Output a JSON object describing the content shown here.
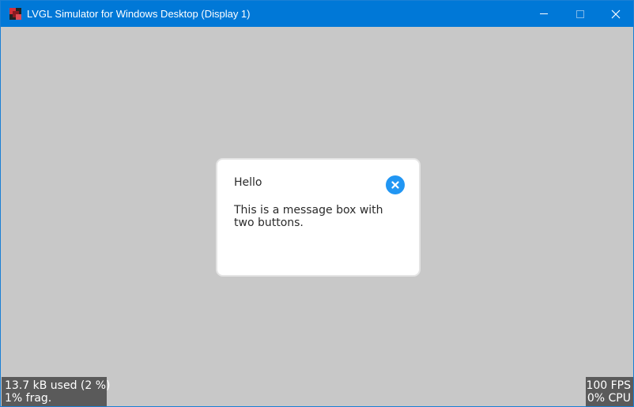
{
  "window": {
    "title": "LVGL Simulator for Windows Desktop (Display 1)"
  },
  "icons": {
    "app": "lvgl-app-icon",
    "minimize": "minimize-icon",
    "maximize": "maximize-icon",
    "close": "close-icon",
    "msgbox_close": "close-circle-icon"
  },
  "colors": {
    "titlebar": "#0078d7",
    "screen_bg": "#c8c8c8",
    "accent": "#2196f3",
    "overlay_bg": "#5a5a5a"
  },
  "msgbox": {
    "title": "Hello",
    "text": "This is a message box with two buttons."
  },
  "monitor": {
    "memory_used": "13.7 kB used (2 %)",
    "fragmentation": "1% frag.",
    "fps": "100 FPS",
    "cpu": "0% CPU"
  }
}
